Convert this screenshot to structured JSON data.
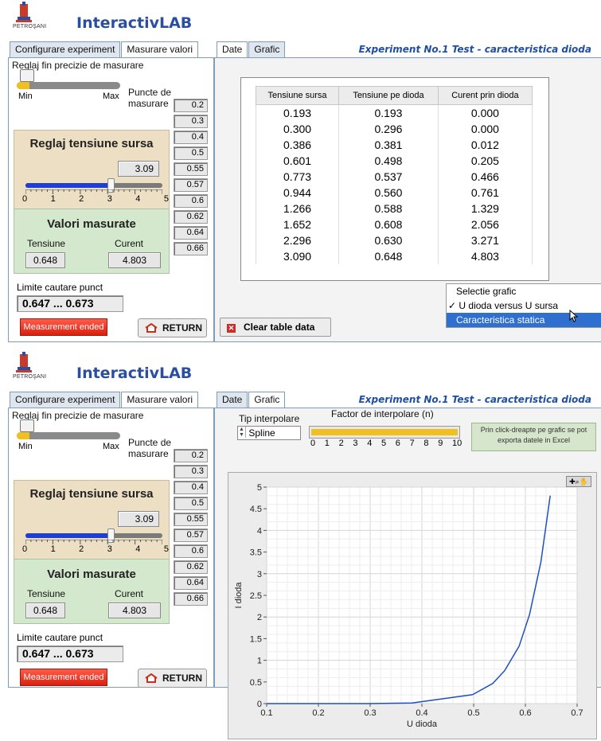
{
  "app": {
    "logo_text": "PETROŞANI",
    "title": "InteractivLAB"
  },
  "tabs_left": [
    "Configurare experiment",
    "Masurare valori"
  ],
  "tabs_right": [
    "Date",
    "Grafic"
  ],
  "experiment_title": "Experiment No.1 Test - caracteristica dioda",
  "controls": {
    "fine_label": "Reglaj fin precizie de masurare",
    "fine_min": "Min",
    "fine_max": "Max",
    "puncte_label": "Puncte de masurare",
    "puncte": [
      "0.2",
      "0.3",
      "0.4",
      "0.5",
      "0.55",
      "0.57",
      "0.6",
      "0.62",
      "0.64",
      "0.66"
    ],
    "reglaj_title": "Reglaj tensiune sursa",
    "reglaj_value": "3.09",
    "reglaj_fraction": 0.618,
    "scale_labels": [
      "0",
      "1",
      "2",
      "3",
      "4",
      "5"
    ],
    "valori_title": "Valori masurate",
    "tensiune_label": "Tensiune",
    "curent_label": "Curent",
    "tensiune_value": "0.648",
    "curent_value": "4.803",
    "limite_label": "Limite cautare punct",
    "limite_value": "0.647  ...  0.673",
    "measurement_button": "Measurement ended",
    "return_button": "RETURN"
  },
  "table": {
    "headers": [
      "Tensiune sursa",
      "Tensiune pe dioda",
      "Curent prin dioda"
    ],
    "rows": [
      [
        "0.193",
        "0.193",
        "0.000"
      ],
      [
        "0.300",
        "0.296",
        "0.000"
      ],
      [
        "0.386",
        "0.381",
        "0.012"
      ],
      [
        "0.601",
        "0.498",
        "0.205"
      ],
      [
        "0.773",
        "0.537",
        "0.466"
      ],
      [
        "0.944",
        "0.560",
        "0.761"
      ],
      [
        "1.266",
        "0.588",
        "1.329"
      ],
      [
        "1.652",
        "0.608",
        "2.056"
      ],
      [
        "2.296",
        "0.630",
        "3.271"
      ],
      [
        "3.090",
        "0.648",
        "4.803"
      ]
    ]
  },
  "graph_menu": {
    "items": [
      "Selectie grafic",
      "U dioda versus U sursa",
      "Caracteristica statica"
    ],
    "checked": "U dioda versus U sursa",
    "highlighted": "Caracteristica statica"
  },
  "clear_button": "Clear table data",
  "interp": {
    "tip_label": "Tip interpolare",
    "tip_value": "Spline",
    "factor_label": "Factor de interpolare (n)",
    "factor_value": 10,
    "factor_scale": [
      "0",
      "1",
      "2",
      "3",
      "4",
      "5",
      "6",
      "7",
      "8",
      "9",
      "10"
    ],
    "hint": "Prin click-dreapte pe grafic se pot exporta datele in Excel"
  },
  "chart_data": {
    "type": "line",
    "xlabel": "U dioda",
    "ylabel": "I dioda",
    "xlim": [
      0.1,
      0.7
    ],
    "ylim": [
      0,
      5
    ],
    "xticks": [
      "0.1",
      "0.2",
      "0.3",
      "0.4",
      "0.5",
      "0.6",
      "0.7"
    ],
    "yticks": [
      "0",
      "0.5",
      "1",
      "1.5",
      "2",
      "2.5",
      "3",
      "3.5",
      "4",
      "4.5",
      "5"
    ],
    "grid": true,
    "line_color": "#1f4fbf",
    "x": [
      0.193,
      0.296,
      0.381,
      0.498,
      0.537,
      0.56,
      0.588,
      0.608,
      0.63,
      0.648
    ],
    "y": [
      0.0,
      0.0,
      0.012,
      0.205,
      0.466,
      0.761,
      1.329,
      2.056,
      3.271,
      4.803
    ]
  }
}
